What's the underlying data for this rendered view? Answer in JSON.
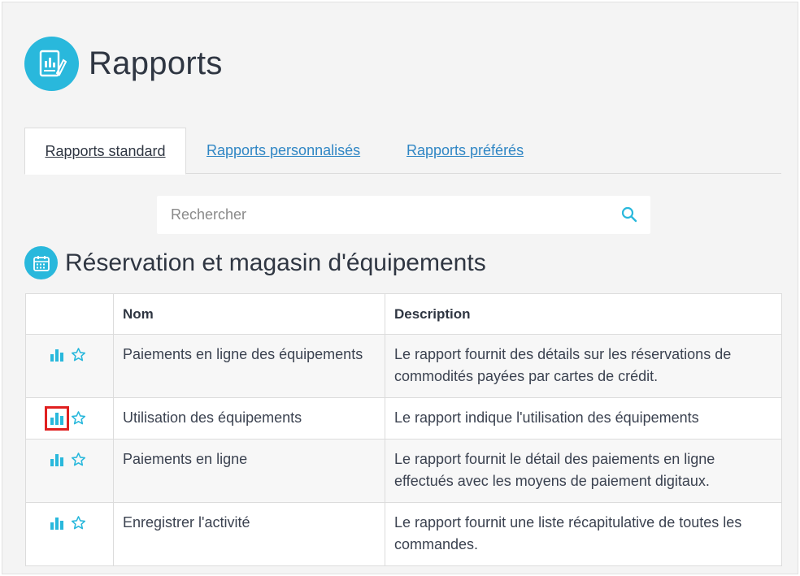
{
  "page": {
    "title": "Rapports"
  },
  "tabs": [
    {
      "label": "Rapports standard",
      "active": true
    },
    {
      "label": "Rapports personnalisés",
      "active": false
    },
    {
      "label": "Rapports préférés",
      "active": false
    }
  ],
  "search": {
    "placeholder": "Rechercher",
    "value": ""
  },
  "section": {
    "title": "Réservation et magasin d'équipements"
  },
  "table": {
    "headers": [
      "",
      "Nom",
      "Description"
    ],
    "rows": [
      {
        "name": "Paiements en ligne des équipements",
        "description": "Le rapport fournit des détails sur les réservations de commodités payées par cartes de crédit."
      },
      {
        "name": "Utilisation des équipements",
        "description": "Le rapport indique l'utilisation des équipements"
      },
      {
        "name": "Paiements en ligne",
        "description": "Le rapport fournit le détail des paiements en ligne effectués avec les moyens de paiement digitaux."
      },
      {
        "name": "Enregistrer l'activité",
        "description": "Le rapport fournit une liste récapitulative de toutes les commandes."
      }
    ]
  },
  "icons": {
    "logo": "report-document-icon",
    "section": "calendar-icon",
    "search": "search-icon",
    "row_chart": "bar-chart-icon",
    "row_favorite": "star-outline-icon"
  },
  "colors": {
    "accent": "#29b8dc",
    "link": "#2f86c4",
    "highlight": "#e02020",
    "background": "#f4f4f4"
  }
}
